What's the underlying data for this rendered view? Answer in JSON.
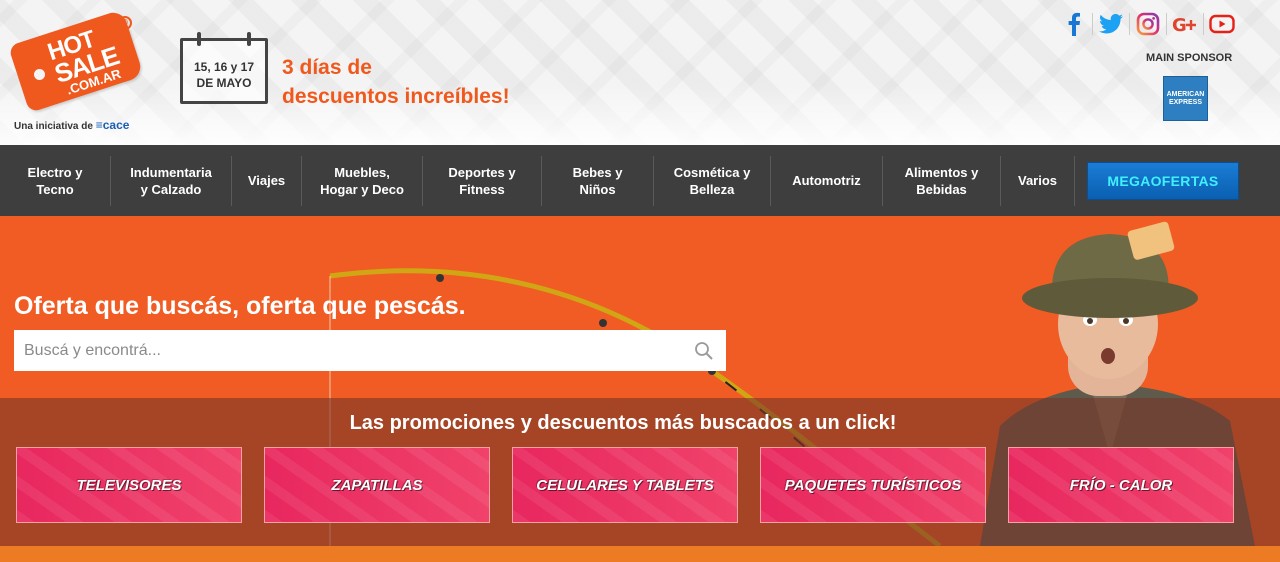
{
  "header": {
    "logo": {
      "line1": "HOT",
      "line2": "SALE",
      "line3": ".COM.AR",
      "registered": "®"
    },
    "initiative": {
      "prefix": "Una iniciativa de",
      "brand": "cace"
    },
    "calendar": {
      "dates": "15, 16 y 17",
      "month": "DE MAYO"
    },
    "tagline_line1": "3 días de",
    "tagline_line2": "descuentos increíbles!",
    "socials": [
      "facebook-icon",
      "twitter-icon",
      "instagram-icon",
      "google-plus-icon",
      "youtube-icon"
    ],
    "sponsor_label": "MAIN SPONSOR",
    "sponsor": {
      "line1": "AMERICAN",
      "line2": "EXPRESS"
    }
  },
  "nav": {
    "items": [
      {
        "label_line1": "Electro y",
        "label_line2": "Tecno"
      },
      {
        "label_line1": "Indumentaria",
        "label_line2": "y Calzado"
      },
      {
        "label_line1": "Viajes",
        "label_line2": ""
      },
      {
        "label_line1": "Muebles,",
        "label_line2": "Hogar y Deco"
      },
      {
        "label_line1": "Deportes y",
        "label_line2": "Fitness"
      },
      {
        "label_line1": "Bebes y",
        "label_line2": "Niños"
      },
      {
        "label_line1": "Cosmética y",
        "label_line2": "Belleza"
      },
      {
        "label_line1": "Automotriz",
        "label_line2": ""
      },
      {
        "label_line1": "Alimentos y",
        "label_line2": "Bebidas"
      },
      {
        "label_line1": "Varios",
        "label_line2": ""
      }
    ],
    "mega_label": "MEGAOFERTAS"
  },
  "hero": {
    "title": "Oferta que buscás, oferta que pescás.",
    "search_placeholder": "Buscá y encontrá...",
    "promo_title": "Las promociones y descuentos más buscados a un click!",
    "promos": [
      "TELEVISORES",
      "ZAPATILLAS",
      "CELULARES Y TABLETS",
      "PAQUETES TURÍSTICOS",
      "FRÍO - CALOR"
    ]
  },
  "colors": {
    "brand_orange": "#f05c23",
    "nav_bg": "#3e3e3f",
    "promo_pink": "#ea2f63",
    "mega_blue": "#1a7dd6"
  }
}
